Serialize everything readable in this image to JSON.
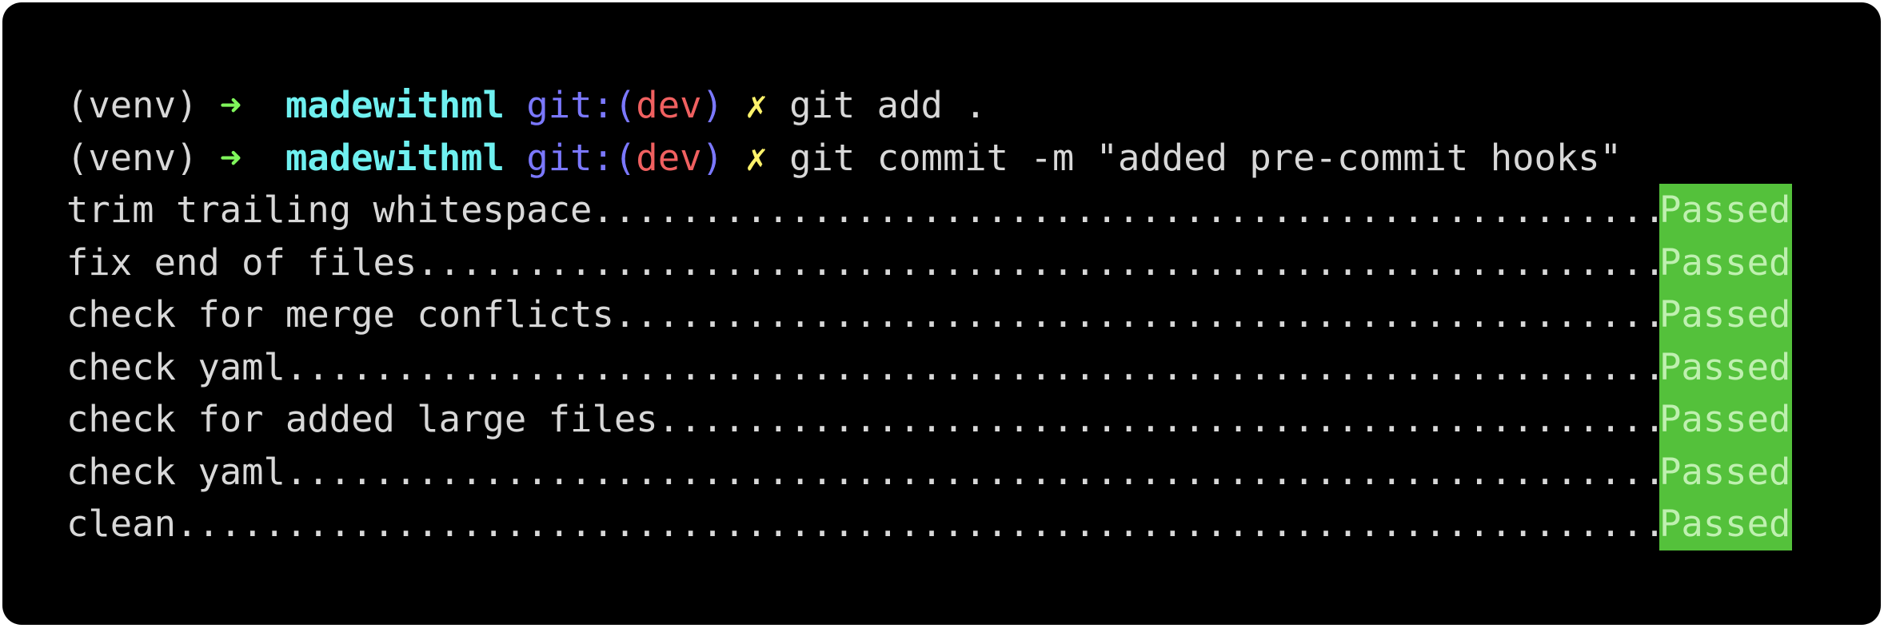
{
  "prompt": {
    "venv": "(venv)",
    "arrow": "➜",
    "directory": "madewithml",
    "git_label_open": "git:(",
    "branch": "dev",
    "git_label_close": ")",
    "dirty_mark": "✗"
  },
  "commands": [
    "git add .",
    "git commit -m \"added pre-commit hooks\""
  ],
  "hooks": [
    {
      "name": "trim trailing whitespace",
      "status": "Passed"
    },
    {
      "name": "fix end of files",
      "status": "Passed"
    },
    {
      "name": "check for merge conflicts",
      "status": "Passed"
    },
    {
      "name": "check yaml",
      "status": "Passed"
    },
    {
      "name": "check for added large files",
      "status": "Passed"
    },
    {
      "name": "check yaml",
      "status": "Passed"
    },
    {
      "name": "clean",
      "status": "Passed"
    }
  ],
  "colors": {
    "background": "#000000",
    "text": "#d8d8d8",
    "arrow": "#7ff55b",
    "directory": "#6ff0f0",
    "git_label": "#7b78ff",
    "branch": "#f06060",
    "dirty_mark": "#fff36b",
    "passed_bg": "#54c13b"
  }
}
